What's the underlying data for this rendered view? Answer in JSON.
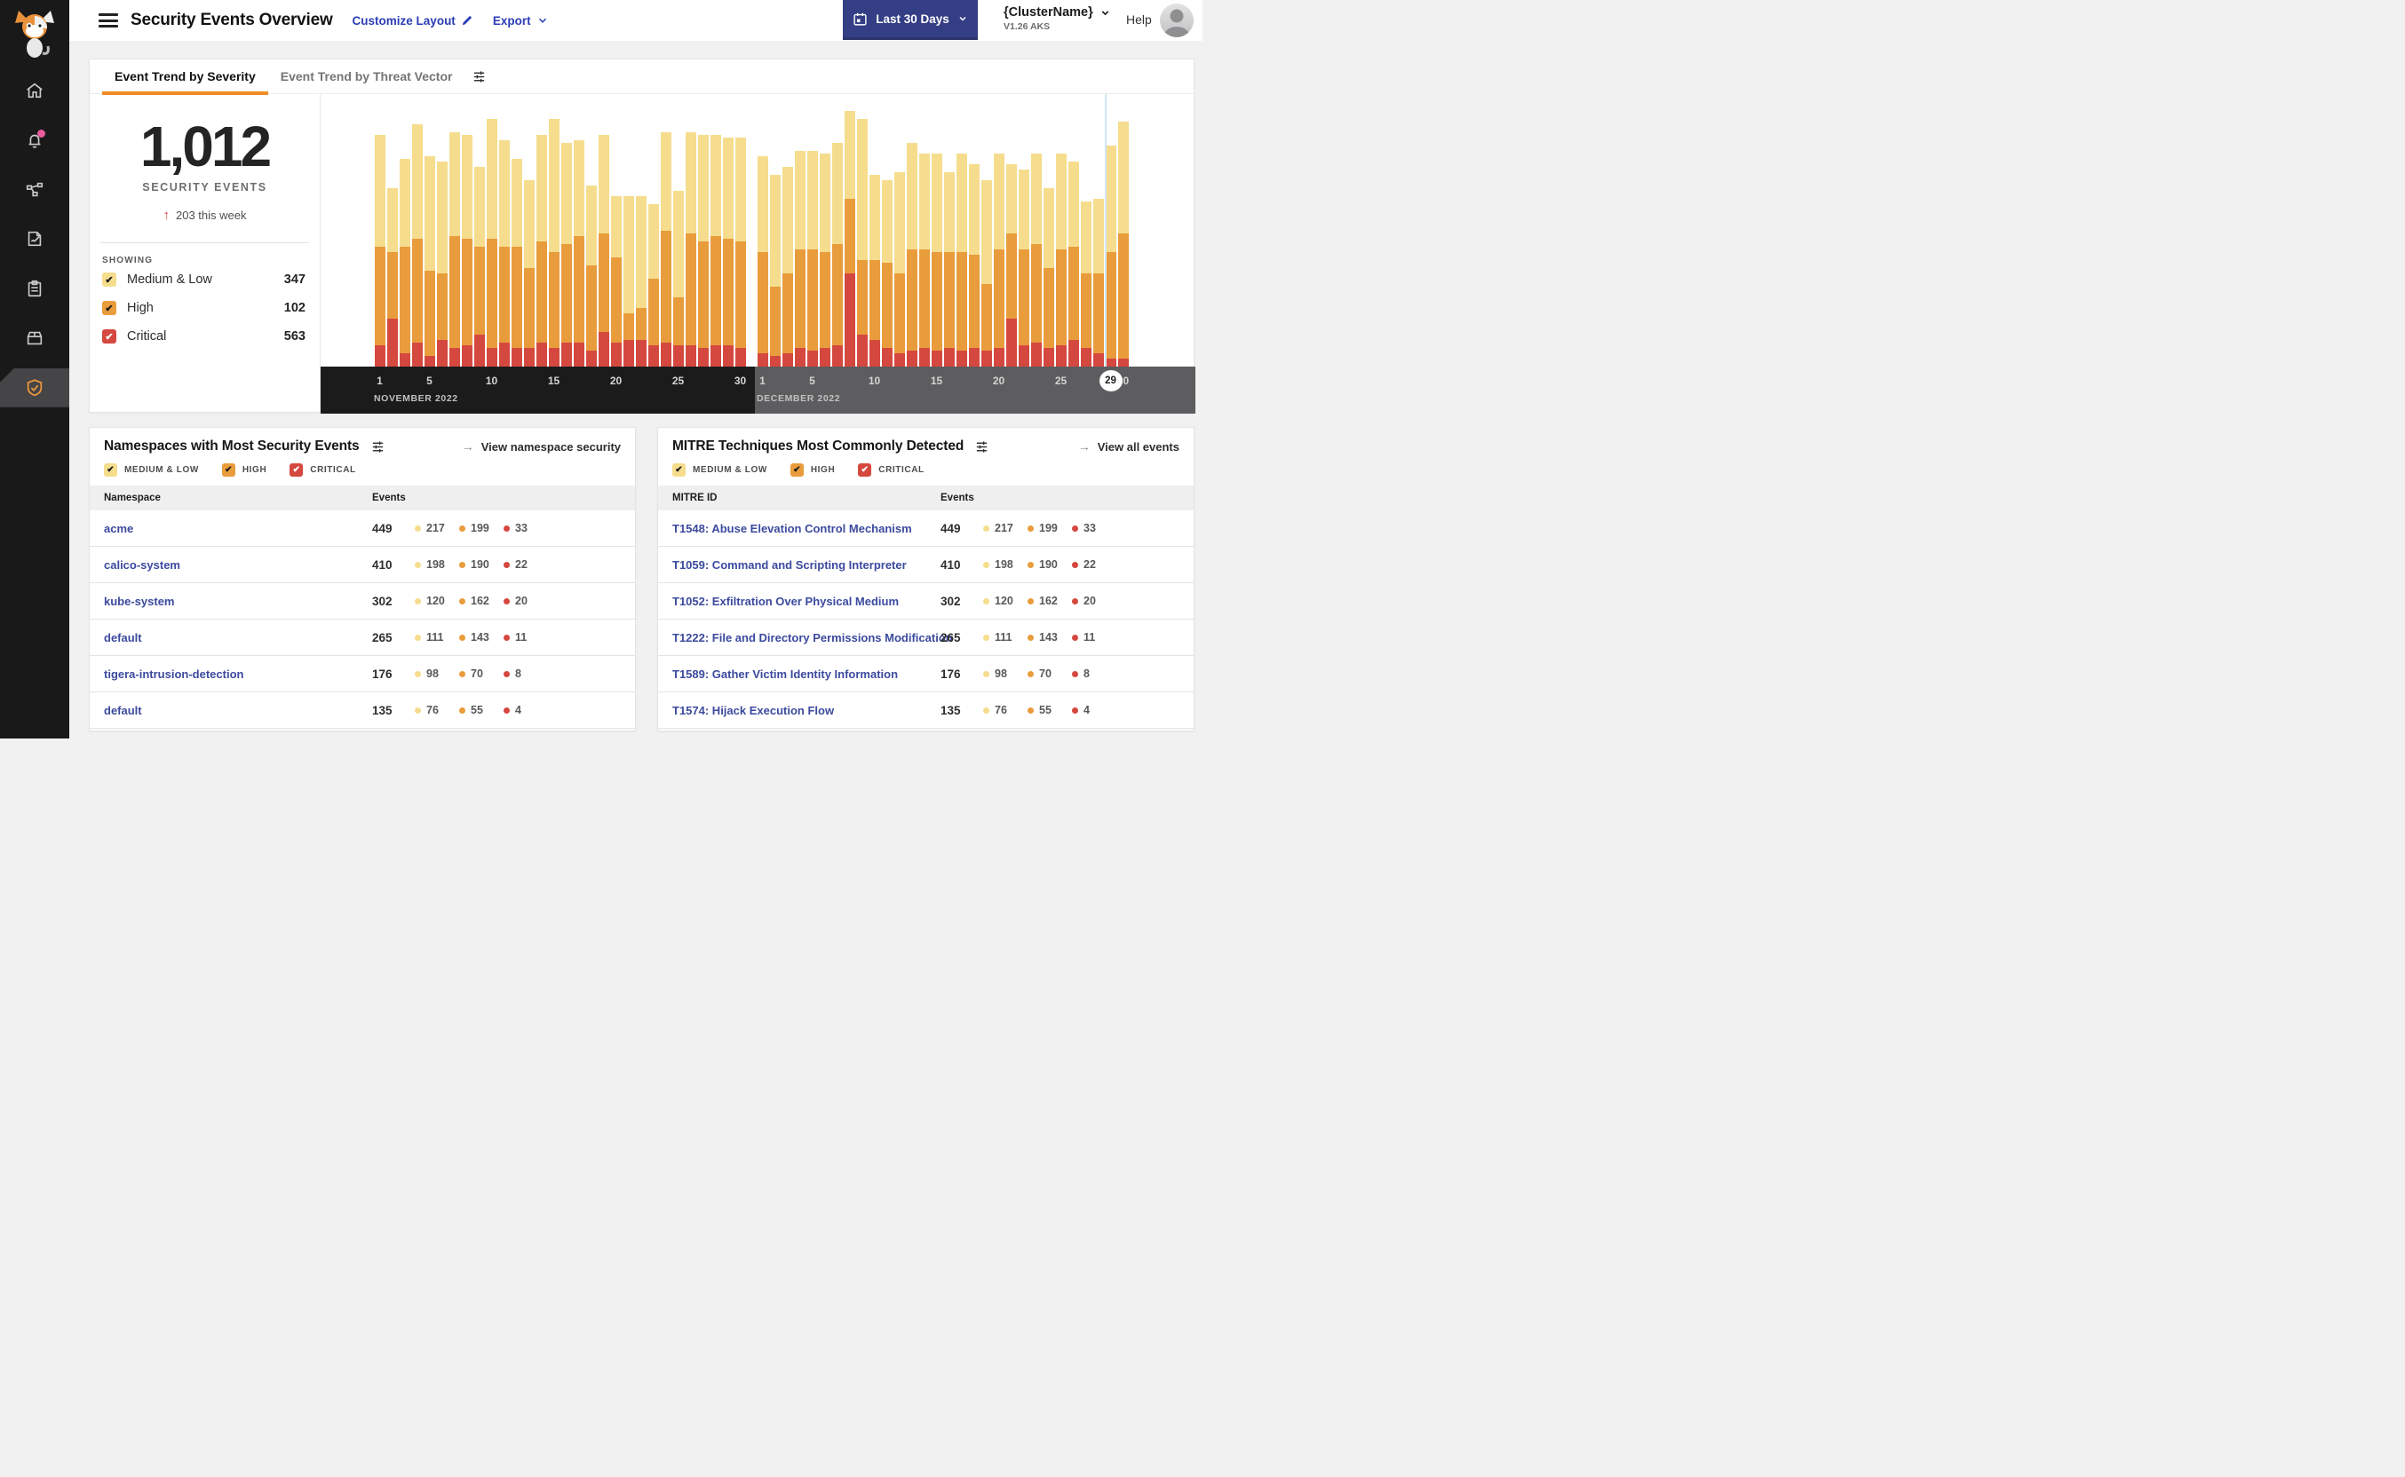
{
  "colors": {
    "medium_low": "#f5dd8d",
    "high": "#e99c3c",
    "critical": "#d5483f",
    "accent_orange": "#ef8c22",
    "navy_button": "#343e85",
    "link_blue": "#2b3eb5",
    "table_link": "#3c4a9e",
    "today_line": "#cfe7f5",
    "nov_band": "#1b1b1c",
    "dec_band": "#5d5c5e",
    "sidebar_bg": "#19191a",
    "badge_pink": "#ea5c9c"
  },
  "header": {
    "title": "Security Events Overview",
    "customize_label": "Customize Layout",
    "export_label": "Export",
    "date_range_label": "Last 30 Days",
    "cluster_name": "{ClusterName}",
    "cluster_version": "V1.26 AKS",
    "help_label": "Help"
  },
  "sidebar": {
    "items": [
      {
        "name": "home",
        "icon": "home",
        "active": false,
        "badge": false
      },
      {
        "name": "alerts",
        "icon": "bell",
        "active": false,
        "badge": true
      },
      {
        "name": "service-graph",
        "icon": "nodes",
        "active": false,
        "badge": false
      },
      {
        "name": "policies",
        "icon": "doc-edit",
        "active": false,
        "badge": false
      },
      {
        "name": "compliance",
        "icon": "clipboard",
        "active": false,
        "badge": false
      },
      {
        "name": "workloads",
        "icon": "box",
        "active": false,
        "badge": false
      },
      {
        "name": "threat-defense",
        "icon": "shield-check",
        "active": true,
        "badge": false
      }
    ]
  },
  "trend_card": {
    "tabs": [
      {
        "label": "Event Trend by Severity",
        "active": true
      },
      {
        "label": "Event Trend by Threat Vector",
        "active": false
      }
    ],
    "stats": {
      "total": "1,012",
      "label": "SECURITY EVENTS",
      "delta": "203 this week"
    },
    "showing": {
      "label": "SHOWING",
      "items": [
        {
          "label": "Medium & Low",
          "value": "347",
          "severity": "medium_low",
          "checked": true,
          "check_color": "#1a1a1a"
        },
        {
          "label": "High",
          "value": "102",
          "severity": "high",
          "checked": true,
          "check_color": "#1a1a1a"
        },
        {
          "label": "Critical",
          "value": "563",
          "severity": "critical",
          "checked": true,
          "check_color": "#ffffff"
        }
      ]
    },
    "chart_data": {
      "type": "stacked_bar",
      "units": "relative height, percent of chart max (values estimated from pixels)",
      "ylim": [
        0,
        100
      ],
      "legend_position": "left-panel",
      "grid": false,
      "months": [
        {
          "label": "NOVEMBER 2022",
          "days": 30,
          "ticks": [
            1,
            5,
            10,
            15,
            20,
            25,
            30
          ]
        },
        {
          "label": "DECEMBER 2022",
          "days": 30,
          "ticks": [
            1,
            5,
            10,
            15,
            20,
            25,
            30
          ]
        }
      ],
      "today_marker": {
        "month_index": 1,
        "day": 29
      },
      "series": [
        {
          "name": "Critical",
          "color_key": "critical",
          "values": [
            8,
            18,
            5,
            9,
            4,
            10,
            7,
            8,
            12,
            7,
            9,
            7,
            7,
            9,
            7,
            9,
            9,
            6,
            13,
            9,
            10,
            10,
            8,
            9,
            8,
            8,
            7,
            8,
            8,
            7,
            5,
            4,
            5,
            7,
            6,
            7,
            8,
            35,
            12,
            10,
            7,
            5,
            6,
            7,
            6,
            7,
            6,
            7,
            6,
            7,
            18,
            8,
            9,
            7,
            8,
            10,
            7,
            5,
            3,
            3
          ]
        },
        {
          "name": "High",
          "color_key": "high",
          "values": [
            37,
            25,
            40,
            39,
            32,
            25,
            42,
            40,
            33,
            41,
            36,
            38,
            30,
            38,
            36,
            37,
            40,
            32,
            37,
            32,
            10,
            12,
            25,
            42,
            18,
            42,
            40,
            41,
            40,
            40,
            38,
            26,
            30,
            37,
            38,
            36,
            38,
            28,
            28,
            30,
            32,
            30,
            38,
            37,
            37,
            36,
            37,
            35,
            25,
            37,
            32,
            36,
            37,
            30,
            36,
            35,
            28,
            30,
            40,
            47
          ]
        },
        {
          "name": "Medium & Low",
          "color_key": "medium_low",
          "values": [
            42,
            24,
            33,
            43,
            43,
            42,
            39,
            39,
            30,
            45,
            40,
            33,
            33,
            40,
            50,
            38,
            36,
            30,
            37,
            23,
            44,
            42,
            28,
            37,
            40,
            38,
            40,
            38,
            38,
            39,
            36,
            42,
            40,
            37,
            37,
            37,
            38,
            33,
            53,
            32,
            31,
            38,
            40,
            36,
            37,
            30,
            37,
            34,
            39,
            36,
            26,
            30,
            34,
            30,
            36,
            32,
            27,
            28,
            40,
            42
          ]
        }
      ]
    }
  },
  "namespaces_card": {
    "title": "Namespaces with Most Security Events",
    "link_label": "View namespace security",
    "filters": [
      {
        "label": "MEDIUM & LOW",
        "severity": "medium_low",
        "checked": true,
        "check_color": "#1a1a1a"
      },
      {
        "label": "HIGH",
        "severity": "high",
        "checked": true,
        "check_color": "#1a1a1a"
      },
      {
        "label": "CRITICAL",
        "severity": "critical",
        "checked": true,
        "check_color": "#ffffff"
      }
    ],
    "columns": [
      "Namespace",
      "Events"
    ],
    "rows": [
      {
        "name": "acme",
        "total": "449",
        "medium_low": "217",
        "high": "199",
        "critical": "33"
      },
      {
        "name": "calico-system",
        "total": "410",
        "medium_low": "198",
        "high": "190",
        "critical": "22"
      },
      {
        "name": "kube-system",
        "total": "302",
        "medium_low": "120",
        "high": "162",
        "critical": "20"
      },
      {
        "name": "default",
        "total": "265",
        "medium_low": "111",
        "high": "143",
        "critical": "11"
      },
      {
        "name": "tigera-intrusion-detection",
        "total": "176",
        "medium_low": "98",
        "high": "70",
        "critical": "8"
      },
      {
        "name": "default",
        "total": "135",
        "medium_low": "76",
        "high": "55",
        "critical": "4"
      }
    ]
  },
  "mitre_card": {
    "title": "MITRE Techniques Most Commonly Detected",
    "link_label": "View all events",
    "filters": [
      {
        "label": "MEDIUM & LOW",
        "severity": "medium_low",
        "checked": true,
        "check_color": "#1a1a1a"
      },
      {
        "label": "HIGH",
        "severity": "high",
        "checked": true,
        "check_color": "#1a1a1a"
      },
      {
        "label": "CRITICAL",
        "severity": "critical",
        "checked": true,
        "check_color": "#ffffff"
      }
    ],
    "columns": [
      "MITRE ID",
      "Events"
    ],
    "rows": [
      {
        "name": "T1548: Abuse Elevation Control Mechanism",
        "total": "449",
        "medium_low": "217",
        "high": "199",
        "critical": "33"
      },
      {
        "name": "T1059: Command and Scripting Interpreter",
        "total": "410",
        "medium_low": "198",
        "high": "190",
        "critical": "22"
      },
      {
        "name": "T1052: Exfiltration Over Physical Medium",
        "total": "302",
        "medium_low": "120",
        "high": "162",
        "critical": "20"
      },
      {
        "name": "T1222: File and Directory Permissions Modification",
        "total": "265",
        "medium_low": "111",
        "high": "143",
        "critical": "11"
      },
      {
        "name": "T1589: Gather Victim Identity Information",
        "total": "176",
        "medium_low": "98",
        "high": "70",
        "critical": "8"
      },
      {
        "name": "T1574: Hijack Execution Flow",
        "total": "135",
        "medium_low": "76",
        "high": "55",
        "critical": "4"
      }
    ]
  }
}
